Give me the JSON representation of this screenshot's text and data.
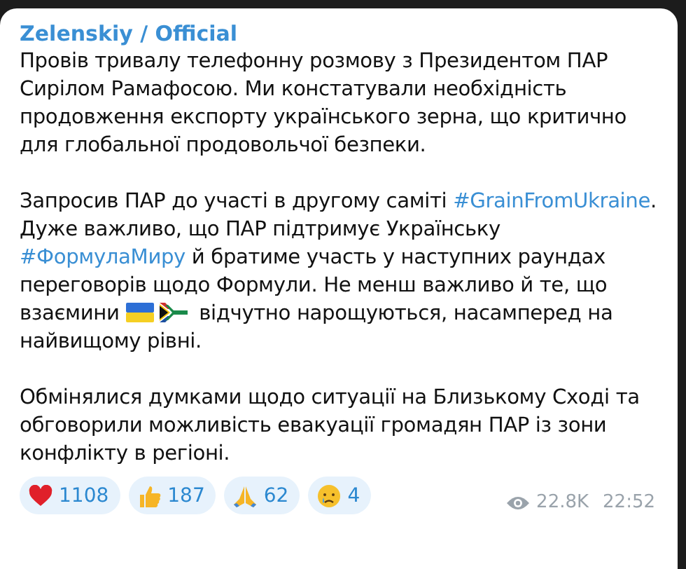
{
  "message": {
    "author": "Zelenskiy / Official",
    "paragraphs": [
      [
        {
          "kind": "text",
          "text": "Провів тривалу телефонну розмову з Президентом ПАР Сирілом Рамафосою. Ми констатували необхідність продовження експорту українського зерна, що критично для глобальної продовольчої безпеки."
        }
      ],
      [
        {
          "kind": "text",
          "text": "Запросив ПАР до участі в другому саміті "
        },
        {
          "kind": "hashtag",
          "text": "#GrainFromUkraine"
        },
        {
          "kind": "text",
          "text": ". Дуже важливо, що ПАР підтримує Українську "
        },
        {
          "kind": "hashtag",
          "text": "#ФормулаМиру"
        },
        {
          "kind": "text",
          "text": " й братиме участь у наступних раундах переговорів щодо Формули. Не менш важливо й те, що взаємини "
        },
        {
          "kind": "uaflag"
        },
        {
          "kind": "zaflag"
        },
        {
          "kind": "text",
          "text": " відчутно нарощуються, насамперед на найвищому рівні."
        }
      ],
      [
        {
          "kind": "text",
          "text": "Обмінялися думками щодо ситуації на Близькому Сході та обговорили можливість евакуації громадян ПАР із зони конфлікту в регіоні."
        }
      ]
    ],
    "reactions": [
      {
        "kind": "heart",
        "count": "1108"
      },
      {
        "kind": "thumbsup",
        "count": "187"
      },
      {
        "kind": "pray",
        "count": "62"
      },
      {
        "kind": "crying",
        "count": "4"
      }
    ],
    "views": "22.8K",
    "time": "22:52"
  }
}
